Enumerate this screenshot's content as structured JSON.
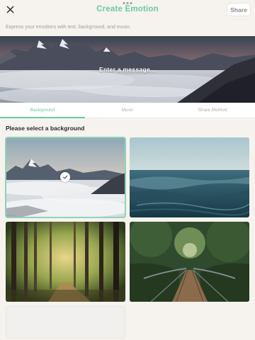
{
  "header": {
    "title": "Create Emotion",
    "share_label": "Share",
    "close_icon": "close-icon",
    "title_color": "#6cc7a8"
  },
  "subtitle": "Express your emotions with text, background, and music.",
  "hero": {
    "placeholder": "Enter a message..."
  },
  "tabs": [
    {
      "label": "Background",
      "active": true
    },
    {
      "label": "Music",
      "active": false
    },
    {
      "label": "Share Method",
      "active": false
    }
  ],
  "section_title": "Please select a background",
  "backgrounds": [
    {
      "name": "mountain-sea-of-clouds",
      "selected": true
    },
    {
      "name": "ocean-waves",
      "selected": false
    },
    {
      "name": "forest-path",
      "selected": false
    },
    {
      "name": "wooden-bridge",
      "selected": false
    },
    {
      "name": "blank",
      "selected": false
    }
  ],
  "colors": {
    "accent": "#6cc7a8",
    "background": "#f6f3ee"
  }
}
